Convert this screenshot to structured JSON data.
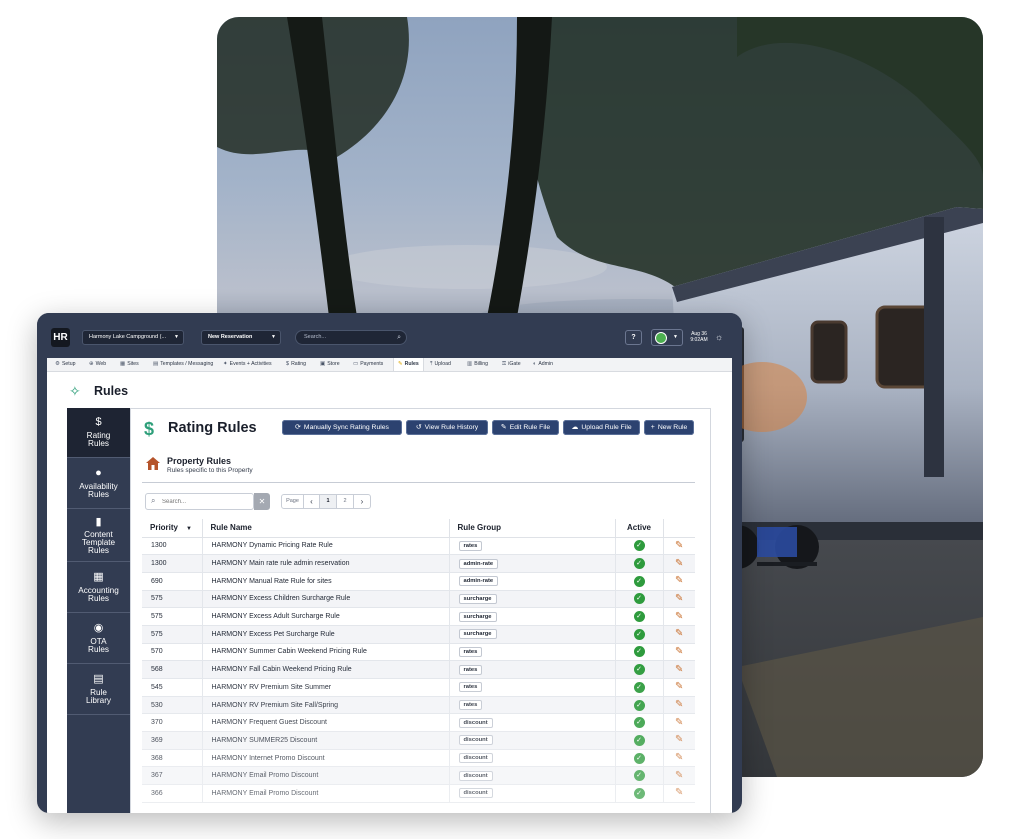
{
  "topbar": {
    "logo": "HR",
    "property_select": "Harmony Lake Campground (...",
    "reservation_select": "New Reservation",
    "search_placeholder": "Search...",
    "help": "?",
    "date_line1": "Aug 36",
    "date_line2": "9:02AM"
  },
  "nav": [
    {
      "icon": "⚙",
      "label": "Setup"
    },
    {
      "icon": "⊕",
      "label": "Web"
    },
    {
      "icon": "▦",
      "label": "Sites"
    },
    {
      "icon": "▤",
      "label": "Templates / Messaging"
    },
    {
      "icon": "✦",
      "label": "Events + Activities"
    },
    {
      "icon": "$",
      "label": "Rating"
    },
    {
      "icon": "▣",
      "label": "Store"
    },
    {
      "icon": "▭",
      "label": "Payments"
    },
    {
      "icon": "✎",
      "label": "Rules"
    },
    {
      "icon": "⤒",
      "label": "Upload"
    },
    {
      "icon": "▥",
      "label": "Billing"
    },
    {
      "icon": "⚿",
      "label": "iGate"
    },
    {
      "icon": "◐",
      "label": "Admin"
    }
  ],
  "page": {
    "title": "Rules"
  },
  "sidebar": [
    {
      "icon": "$",
      "label": "Rating\nRules"
    },
    {
      "icon": "●",
      "label": "Availability\nRules"
    },
    {
      "icon": "▮",
      "label": "Content\nTemplate\nRules"
    },
    {
      "icon": "▦",
      "label": "Accounting\nRules"
    },
    {
      "icon": "◉",
      "label": "OTA\nRules"
    },
    {
      "icon": "▤",
      "label": "Rule\nLibrary"
    }
  ],
  "panel": {
    "icon": "$",
    "title": "Rating Rules",
    "buttons": [
      {
        "icon": "⟳",
        "label": "Manually Sync Rating Rules"
      },
      {
        "icon": "↺",
        "label": "View Rule History"
      },
      {
        "icon": "✎",
        "label": "Edit Rule File"
      },
      {
        "icon": "☁",
        "label": "Upload Rule File"
      },
      {
        "icon": "+",
        "label": "New Rule"
      }
    ],
    "section_title": "Property Rules",
    "section_sub": "Rules specific to this Property",
    "search_placeholder": "Search...",
    "pager": {
      "label": "Page",
      "prev": "‹",
      "next": "›",
      "pages": [
        "1",
        "2"
      ]
    }
  },
  "table": {
    "headers": {
      "priority": "Priority",
      "name": "Rule Name",
      "group": "Rule Group",
      "active": "Active"
    },
    "rows": [
      {
        "priority": "1300",
        "name": "HARMONY Dynamic Pricing Rate Rule",
        "group": "rates"
      },
      {
        "priority": "1300",
        "name": "HARMONY Main rate rule admin reservation",
        "group": "admin-rate"
      },
      {
        "priority": "690",
        "name": "HARMONY Manual Rate Rule for sites",
        "group": "admin-rate"
      },
      {
        "priority": "575",
        "name": "HARMONY Excess Children Surcharge Rule",
        "group": "surcharge"
      },
      {
        "priority": "575",
        "name": "HARMONY Excess Adult Surcharge Rule",
        "group": "surcharge"
      },
      {
        "priority": "575",
        "name": "HARMONY Excess Pet Surcharge Rule",
        "group": "surcharge"
      },
      {
        "priority": "570",
        "name": "HARMONY Summer Cabin Weekend Pricing Rule",
        "group": "rates"
      },
      {
        "priority": "568",
        "name": "HARMONY Fall Cabin Weekend Pricing Rule",
        "group": "rates"
      },
      {
        "priority": "545",
        "name": "HARMONY RV Premium Site Summer",
        "group": "rates"
      },
      {
        "priority": "530",
        "name": "HARMONY RV Premium Site Fall/Spring",
        "group": "rates"
      },
      {
        "priority": "370",
        "name": "HARMONY Frequent Guest Discount",
        "group": "discount"
      },
      {
        "priority": "369",
        "name": "HARMONY SUMMER25 Discount",
        "group": "discount"
      },
      {
        "priority": "368",
        "name": "HARMONY Internet Promo Discount",
        "group": "discount"
      },
      {
        "priority": "367",
        "name": "HARMONY Email Promo Discount",
        "group": "discount"
      },
      {
        "priority": "366",
        "name": "HARMONY Email Promo Discount",
        "group": "discount"
      }
    ]
  },
  "colors": {
    "navy": "#323c52",
    "button": "#2c4270",
    "active_green": "#2e9b3d",
    "edit_orange": "#c86e2c",
    "accent_teal": "#2e9f7a"
  }
}
